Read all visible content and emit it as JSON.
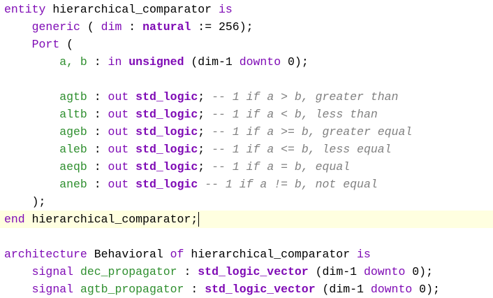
{
  "colors": {
    "keyword": "#7f0bb5",
    "port_name": "#2f8f2f",
    "comment": "#808080",
    "current_line_bg": "#ffffe0",
    "text": "#000000"
  },
  "code_lines": [
    {
      "current": false,
      "tokens": [
        [
          "kw",
          "entity"
        ],
        [
          "plain",
          " hierarchical_comparator "
        ],
        [
          "kw",
          "is"
        ]
      ]
    },
    {
      "current": false,
      "tokens": [
        [
          "plain",
          "    "
        ],
        [
          "kw",
          "generic"
        ],
        [
          "plain",
          " ( "
        ],
        [
          "kw",
          "dim"
        ],
        [
          "plain",
          " : "
        ],
        [
          "type",
          "natural"
        ],
        [
          "plain",
          " := 256);"
        ]
      ]
    },
    {
      "current": false,
      "tokens": [
        [
          "plain",
          "    "
        ],
        [
          "kw",
          "Port"
        ],
        [
          "plain",
          " ("
        ]
      ]
    },
    {
      "current": false,
      "tokens": [
        [
          "plain",
          "        "
        ],
        [
          "port",
          "a, b"
        ],
        [
          "plain",
          " : "
        ],
        [
          "kw",
          "in"
        ],
        [
          "plain",
          " "
        ],
        [
          "type",
          "unsigned"
        ],
        [
          "plain",
          " (dim-1 "
        ],
        [
          "kw",
          "downto"
        ],
        [
          "plain",
          " 0);"
        ]
      ]
    },
    {
      "current": false,
      "tokens": []
    },
    {
      "current": false,
      "tokens": [
        [
          "plain",
          "        "
        ],
        [
          "port",
          "agtb"
        ],
        [
          "plain",
          " : "
        ],
        [
          "kw",
          "out"
        ],
        [
          "plain",
          " "
        ],
        [
          "type",
          "std_logic"
        ],
        [
          "plain",
          "; "
        ],
        [
          "comment",
          "-- 1 if a > b, greater than"
        ]
      ]
    },
    {
      "current": false,
      "tokens": [
        [
          "plain",
          "        "
        ],
        [
          "port",
          "altb"
        ],
        [
          "plain",
          " : "
        ],
        [
          "kw",
          "out"
        ],
        [
          "plain",
          " "
        ],
        [
          "type",
          "std_logic"
        ],
        [
          "plain",
          "; "
        ],
        [
          "comment",
          "-- 1 if a < b, less than"
        ]
      ]
    },
    {
      "current": false,
      "tokens": [
        [
          "plain",
          "        "
        ],
        [
          "port",
          "ageb"
        ],
        [
          "plain",
          " : "
        ],
        [
          "kw",
          "out"
        ],
        [
          "plain",
          " "
        ],
        [
          "type",
          "std_logic"
        ],
        [
          "plain",
          "; "
        ],
        [
          "comment",
          "-- 1 if a >= b, greater equal"
        ]
      ]
    },
    {
      "current": false,
      "tokens": [
        [
          "plain",
          "        "
        ],
        [
          "port",
          "aleb"
        ],
        [
          "plain",
          " : "
        ],
        [
          "kw",
          "out"
        ],
        [
          "plain",
          " "
        ],
        [
          "type",
          "std_logic"
        ],
        [
          "plain",
          "; "
        ],
        [
          "comment",
          "-- 1 if a <= b, less equal"
        ]
      ]
    },
    {
      "current": false,
      "tokens": [
        [
          "plain",
          "        "
        ],
        [
          "port",
          "aeqb"
        ],
        [
          "plain",
          " : "
        ],
        [
          "kw",
          "out"
        ],
        [
          "plain",
          " "
        ],
        [
          "type",
          "std_logic"
        ],
        [
          "plain",
          "; "
        ],
        [
          "comment",
          "-- 1 if a = b, equal"
        ]
      ]
    },
    {
      "current": false,
      "tokens": [
        [
          "plain",
          "        "
        ],
        [
          "port",
          "aneb"
        ],
        [
          "plain",
          " : "
        ],
        [
          "kw",
          "out"
        ],
        [
          "plain",
          " "
        ],
        [
          "type",
          "std_logic"
        ],
        [
          "plain",
          " "
        ],
        [
          "comment",
          "-- 1 if a != b, not equal"
        ]
      ]
    },
    {
      "current": false,
      "tokens": [
        [
          "plain",
          "    );"
        ]
      ]
    },
    {
      "current": true,
      "tokens": [
        [
          "kw",
          "end"
        ],
        [
          "plain",
          " hierarchical_comparator;"
        ]
      ]
    },
    {
      "current": false,
      "tokens": []
    },
    {
      "current": false,
      "tokens": [
        [
          "kw",
          "architecture"
        ],
        [
          "plain",
          " Behavioral "
        ],
        [
          "kw",
          "of"
        ],
        [
          "plain",
          " hierarchical_comparator "
        ],
        [
          "kw",
          "is"
        ]
      ]
    },
    {
      "current": false,
      "tokens": [
        [
          "plain",
          "    "
        ],
        [
          "kw",
          "signal"
        ],
        [
          "plain",
          " "
        ],
        [
          "port",
          "dec_propagator"
        ],
        [
          "plain",
          " : "
        ],
        [
          "type",
          "std_logic_vector"
        ],
        [
          "plain",
          " (dim-1 "
        ],
        [
          "kw",
          "downto"
        ],
        [
          "plain",
          " 0);"
        ]
      ]
    },
    {
      "current": false,
      "tokens": [
        [
          "plain",
          "    "
        ],
        [
          "kw",
          "signal"
        ],
        [
          "plain",
          " "
        ],
        [
          "port",
          "agtb_propagator"
        ],
        [
          "plain",
          " : "
        ],
        [
          "type",
          "std_logic_vector"
        ],
        [
          "plain",
          " (dim-1 "
        ],
        [
          "kw",
          "downto"
        ],
        [
          "plain",
          " 0);"
        ]
      ]
    }
  ]
}
